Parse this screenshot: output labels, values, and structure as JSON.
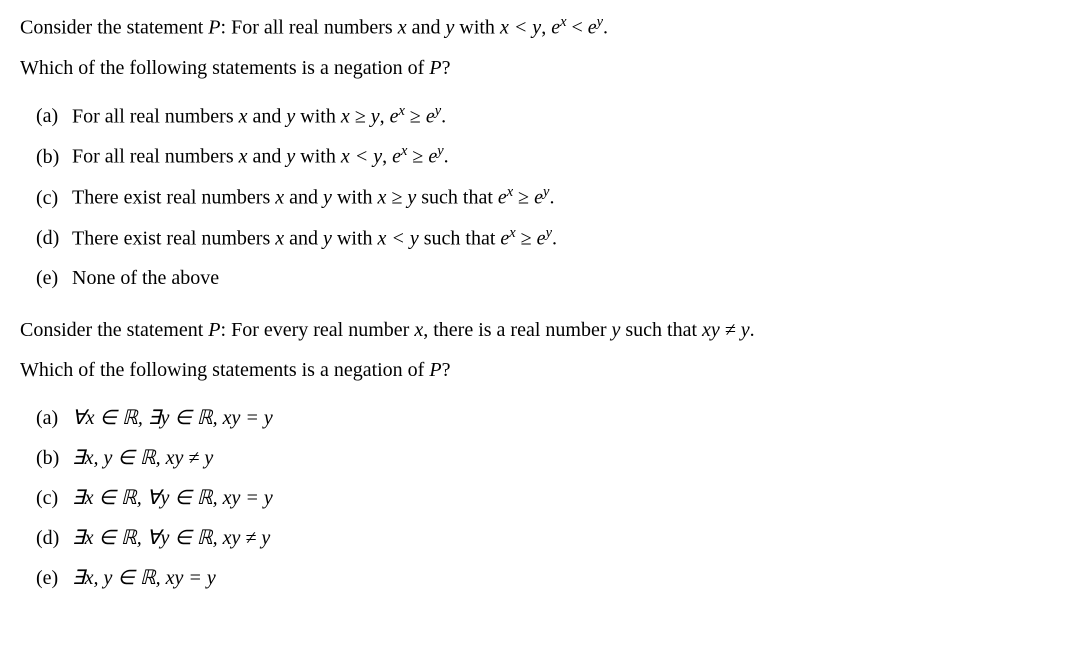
{
  "q1": {
    "prompt1_pre": "Consider the statement ",
    "prompt1_P": "P",
    "prompt1_post": ": For all real numbers ",
    "prompt1_x": "x",
    "prompt1_and": " and ",
    "prompt1_y": "y",
    "prompt1_with": " with ",
    "prompt1_cond": "x < y",
    "prompt1_comma": ", ",
    "prompt1_ex": "e",
    "prompt1_exsup": "x",
    "prompt1_lt": " < ",
    "prompt1_ey": "e",
    "prompt1_eysup": "y",
    "prompt1_end": ".",
    "prompt2": "Which of the following statements is a negation of ",
    "prompt2_P": "P",
    "prompt2_end": "?",
    "a_label": "(a)",
    "a_pre": "For all real numbers ",
    "a_x": "x",
    "a_and": " and ",
    "a_y": "y",
    "a_with": " with ",
    "a_cond": "x ≥ y",
    "a_comma": ", ",
    "a_ex": "e",
    "a_exsup": "x",
    "a_rel": " ≥ ",
    "a_ey": "e",
    "a_eysup": "y",
    "a_end": ".",
    "b_label": "(b)",
    "b_pre": "For all real numbers ",
    "b_x": "x",
    "b_and": " and ",
    "b_y": "y",
    "b_with": " with ",
    "b_cond": "x < y",
    "b_comma": ", ",
    "b_ex": "e",
    "b_exsup": "x",
    "b_rel": " ≥ ",
    "b_ey": "e",
    "b_eysup": "y",
    "b_end": ".",
    "c_label": "(c)",
    "c_pre": "There exist real numbers ",
    "c_x": "x",
    "c_and": " and ",
    "c_y": "y",
    "c_with": " with ",
    "c_cond": "x ≥ y",
    "c_such": " such that ",
    "c_ex": "e",
    "c_exsup": "x",
    "c_rel": " ≥ ",
    "c_ey": "e",
    "c_eysup": "y",
    "c_end": ".",
    "d_label": "(d)",
    "d_pre": "There exist real numbers ",
    "d_x": "x",
    "d_and": " and ",
    "d_y": "y",
    "d_with": " with ",
    "d_cond": "x < y",
    "d_such": " such that ",
    "d_ex": "e",
    "d_exsup": "x",
    "d_rel": " ≥ ",
    "d_ey": "e",
    "d_eysup": "y",
    "d_end": ".",
    "e_label": "(e)",
    "e_text": "None of the above"
  },
  "q2": {
    "prompt1_pre": "Consider the statement ",
    "prompt1_P": "P",
    "prompt1_post": ": For every real number ",
    "prompt1_x": "x",
    "prompt1_mid": ", there is a real number ",
    "prompt1_y": "y",
    "prompt1_such": " such that ",
    "prompt1_expr": "xy ≠ y",
    "prompt1_end": ".",
    "prompt2": "Which of the following statements is a negation of ",
    "prompt2_P": "P",
    "prompt2_end": "?",
    "a_label": "(a)",
    "a_text": "∀x ∈ ℝ, ∃y ∈ ℝ, xy = y",
    "b_label": "(b)",
    "b_text": "∃x, y ∈ ℝ, xy ≠ y",
    "c_label": "(c)",
    "c_text": "∃x ∈ ℝ, ∀y ∈ ℝ, xy = y",
    "d_label": "(d)",
    "d_text": "∃x ∈ ℝ, ∀y ∈ ℝ, xy ≠ y",
    "e_label": "(e)",
    "e_text": "∃x, y ∈ ℝ, xy = y"
  }
}
